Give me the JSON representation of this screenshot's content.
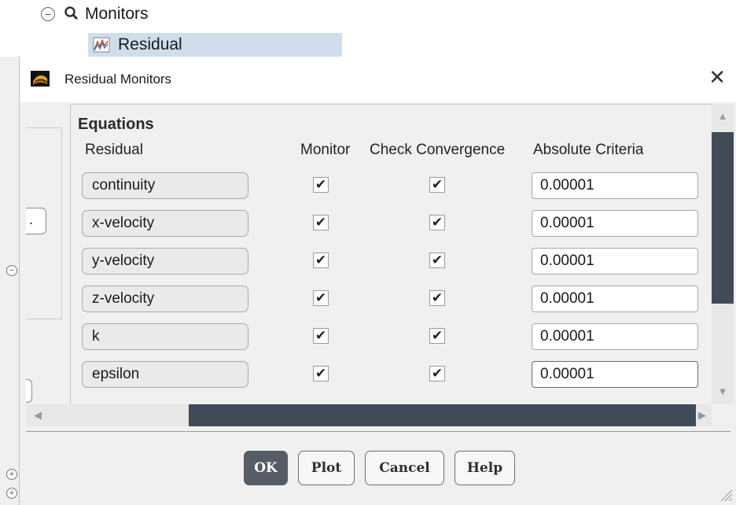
{
  "tree": {
    "monitors_label": "Monitors",
    "residual_label": "Residual"
  },
  "dialog": {
    "title": "Residual Monitors",
    "close_glyph": "✕"
  },
  "left_panel": {
    "button_fragment": "."
  },
  "equations": {
    "section_title": "Equations",
    "headers": {
      "residual": "Residual",
      "monitor": "Monitor",
      "check_convergence": "Check Convergence",
      "absolute_criteria": "Absolute Criteria"
    },
    "rows": [
      {
        "name": "continuity",
        "monitor": true,
        "check": true,
        "criteria": "0.00001"
      },
      {
        "name": "x-velocity",
        "monitor": true,
        "check": true,
        "criteria": "0.00001"
      },
      {
        "name": "y-velocity",
        "monitor": true,
        "check": true,
        "criteria": "0.00001"
      },
      {
        "name": "z-velocity",
        "monitor": true,
        "check": true,
        "criteria": "0.00001"
      },
      {
        "name": "k",
        "monitor": true,
        "check": true,
        "criteria": "0.00001"
      },
      {
        "name": "epsilon",
        "monitor": true,
        "check": true,
        "criteria": "0.00001"
      }
    ],
    "check_glyph": "✔"
  },
  "scrollbars": {
    "up_glyph": "▲",
    "down_glyph": "▼",
    "left_glyph": "◀",
    "right_glyph": "▶"
  },
  "buttons": {
    "ok": "OK",
    "plot": "Plot",
    "cancel": "Cancel",
    "help": "Help"
  },
  "icons": {
    "collapse": "minus-circle-icon",
    "monitors": "magnifier-icon",
    "residual": "residual-plot-icon",
    "app": "fluent-app-icon"
  },
  "colors": {
    "selection": "#cfdded",
    "scroll_thumb": "#404b57",
    "primary_button": "#555c63"
  }
}
